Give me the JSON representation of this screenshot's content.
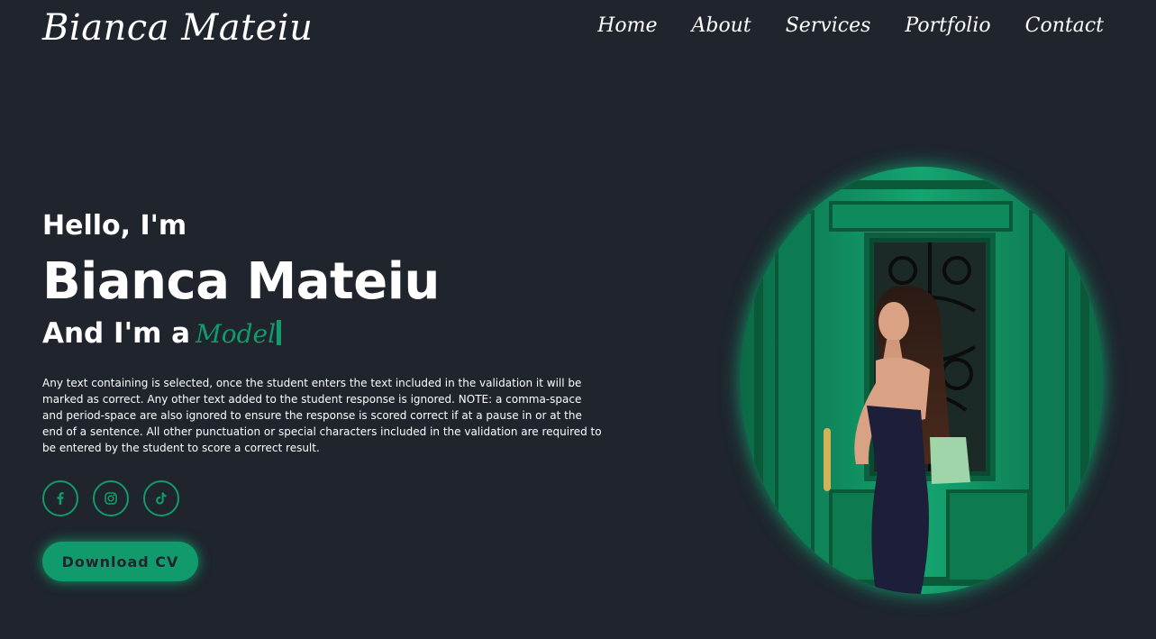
{
  "header": {
    "logo": "Bianca Mateiu",
    "nav": [
      {
        "label": "Home"
      },
      {
        "label": "About"
      },
      {
        "label": "Services"
      },
      {
        "label": "Portfolio"
      },
      {
        "label": "Contact"
      }
    ]
  },
  "hero": {
    "greeting": "Hello, I'm",
    "name": "Bianca Mateiu",
    "role_prefix": "And I'm a",
    "role_typed": "Model",
    "description": "Any text containing is selected, once the student enters the text included in the validation it will be marked as correct. Any other text added to the student response is ignored. NOTE: a comma-space and period-space are also ignored to ensure the response is scored correct if at a pause in or at the end of a sentence. All other punctuation or special characters included in the validation are required to be entered by the student to score a correct result.",
    "download_button": "Download CV"
  },
  "social": [
    {
      "icon": "facebook-icon"
    },
    {
      "icon": "instagram-icon"
    },
    {
      "icon": "tiktok-icon"
    }
  ],
  "colors": {
    "background": "#1f242d",
    "accent": "#119b6c",
    "text": "#ffffff"
  }
}
